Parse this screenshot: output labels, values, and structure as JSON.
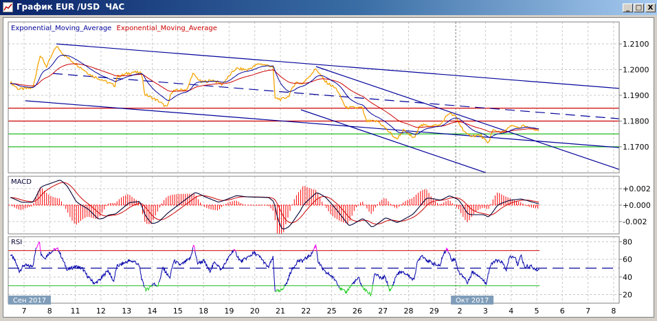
{
  "window": {
    "title": "График EUR /USD  ЧАС",
    "minimize_glyph": "_",
    "maximize_glyph": "□",
    "close_glyph": "X"
  },
  "legend": {
    "ema_fast": "Exponential_Moving_Average",
    "ema_slow": "Exponential_Moving_Average"
  },
  "colors": {
    "price": "#F5A300",
    "ema_fast": "#000099",
    "ema_slow": "#CC0000",
    "trend": "#000099",
    "resistance": "#CC0000",
    "support": "#22BB22",
    "macd": "#000033",
    "signal": "#CC0000",
    "histogram": "#FF0000",
    "rsi": "#0000AA",
    "rsi_over": "#EE00EE",
    "rsi_under": "#22CC22"
  },
  "x_axis": {
    "ticks": [
      {
        "d": 0,
        "label": "7"
      },
      {
        "d": 1,
        "label": "8"
      },
      {
        "d": 2,
        "label": "11"
      },
      {
        "d": 3,
        "label": "12"
      },
      {
        "d": 4,
        "label": "13"
      },
      {
        "d": 5,
        "label": "14"
      },
      {
        "d": 6,
        "label": "15"
      },
      {
        "d": 7,
        "label": "18"
      },
      {
        "d": 8,
        "label": "19"
      },
      {
        "d": 9,
        "label": "20"
      },
      {
        "d": 10,
        "label": "21"
      },
      {
        "d": 11,
        "label": "22"
      },
      {
        "d": 12,
        "label": "25"
      },
      {
        "d": 13,
        "label": "26"
      },
      {
        "d": 14,
        "label": "27"
      },
      {
        "d": 15,
        "label": "28"
      },
      {
        "d": 16,
        "label": "29"
      },
      {
        "d": 17,
        "label": "2"
      },
      {
        "d": 18,
        "label": "3"
      },
      {
        "d": 19,
        "label": "4"
      },
      {
        "d": 20,
        "label": "5"
      },
      {
        "d": 21,
        "label": "6"
      },
      {
        "d": 22,
        "label": "7"
      },
      {
        "d": 23,
        "label": "8"
      }
    ],
    "months": [
      {
        "d": -0.62,
        "label": "Сен 2017"
      },
      {
        "d": 16.84,
        "label": "Окт 2017"
      }
    ],
    "month_separator_d": 16.84
  },
  "chart_data": [
    {
      "type": "line",
      "title": "EUR/USD H1",
      "ylim": [
        1.1599,
        1.2186
      ],
      "xlim": [
        -0.62,
        23.22
      ],
      "yticks": [
        "1.2100",
        "1.2000",
        "1.1900",
        "1.1800",
        "1.1700"
      ],
      "price": [
        [
          -0.54,
          1.1951
        ],
        [
          -0.21,
          1.1924
        ],
        [
          0.35,
          1.1929
        ],
        [
          0.62,
          1.2057
        ],
        [
          0.88,
          1.2012
        ],
        [
          1.26,
          1.2092
        ],
        [
          1.56,
          1.2057
        ],
        [
          2.01,
          1.2023
        ],
        [
          2.63,
          1.1977
        ],
        [
          3.08,
          1.1959
        ],
        [
          3.54,
          1.1937
        ],
        [
          3.62,
          1.1972
        ],
        [
          4.24,
          1.1991
        ],
        [
          4.61,
          1.1985
        ],
        [
          4.69,
          1.1905
        ],
        [
          5.23,
          1.1879
        ],
        [
          5.58,
          1.1852
        ],
        [
          5.76,
          1.1916
        ],
        [
          6.38,
          1.1924
        ],
        [
          6.57,
          1.1985
        ],
        [
          6.92,
          1.1951
        ],
        [
          7.37,
          1.1959
        ],
        [
          7.72,
          1.1943
        ],
        [
          8.26,
          1.2004
        ],
        [
          8.71,
          1.1999
        ],
        [
          9.17,
          1.2023
        ],
        [
          9.71,
          1.2012
        ],
        [
          9.79,
          1.1889
        ],
        [
          10.05,
          1.1884
        ],
        [
          10.32,
          1.1897
        ],
        [
          10.59,
          1.1951
        ],
        [
          10.86,
          1.1945
        ],
        [
          11.15,
          1.1977
        ],
        [
          11.39,
          1.2004
        ],
        [
          11.72,
          1.1956
        ],
        [
          12.2,
          1.1924
        ],
        [
          12.55,
          1.1852
        ],
        [
          13.19,
          1.1852
        ],
        [
          13.35,
          1.1799
        ],
        [
          13.81,
          1.1799
        ],
        [
          14.26,
          1.1756
        ],
        [
          14.53,
          1.1729
        ],
        [
          14.8,
          1.1764
        ],
        [
          15.23,
          1.1732
        ],
        [
          15.42,
          1.1783
        ],
        [
          16.22,
          1.1783
        ],
        [
          16.57,
          1.1831
        ],
        [
          16.84,
          1.1817
        ],
        [
          17.02,
          1.1783
        ],
        [
          17.29,
          1.1745
        ],
        [
          17.83,
          1.1743
        ],
        [
          18.1,
          1.1711
        ],
        [
          18.28,
          1.1764
        ],
        [
          18.71,
          1.1756
        ],
        [
          18.98,
          1.1783
        ],
        [
          19.36,
          1.1772
        ],
        [
          19.44,
          1.1785
        ],
        [
          19.79,
          1.1769
        ],
        [
          20.11,
          1.1761
        ]
      ],
      "levels": [
        {
          "kind": "resistance",
          "value": 1.185
        },
        {
          "kind": "resistance",
          "value": 1.18
        },
        {
          "kind": "support",
          "value": 1.175
        },
        {
          "kind": "support",
          "value": 1.17
        }
      ],
      "trendlines": [
        {
          "from": [
            1.26,
            1.21
          ],
          "to": [
            23.22,
            1.1927
          ],
          "dashed": false
        },
        {
          "from": [
            1.13,
            1.1985
          ],
          "to": [
            23.22,
            1.1809
          ],
          "dashed": true
        },
        {
          "from": [
            0.05,
            1.1879
          ],
          "to": [
            23.22,
            1.1697
          ],
          "dashed": false
        },
        {
          "from": [
            11.39,
            1.2012
          ],
          "to": [
            23.22,
            1.1612
          ],
          "dashed": false
        },
        {
          "from": [
            10.8,
            1.1844
          ],
          "to": [
            18.02,
            1.1599
          ],
          "dashed": false
        }
      ]
    },
    {
      "type": "line",
      "title": "MACD",
      "ylim": [
        -0.0035,
        0.0035
      ],
      "yticks": [
        "+0.002",
        "+0.000",
        "-0.002"
      ],
      "macd": [
        [
          -0.54,
          0.00092
        ],
        [
          -0.13,
          0.00033
        ],
        [
          0.32,
          0.00033
        ],
        [
          0.62,
          0.00225
        ],
        [
          0.94,
          0.00258
        ],
        [
          1.39,
          0.00308
        ],
        [
          1.66,
          0.00225
        ],
        [
          2.01,
          0.00033
        ],
        [
          2.47,
          -0.0005
        ],
        [
          2.87,
          -0.00175
        ],
        [
          3.08,
          -0.00158
        ],
        [
          3.27,
          -0.00117
        ],
        [
          3.54,
          -0.00108
        ],
        [
          4.07,
          0.00033
        ],
        [
          4.5,
          0.00042
        ],
        [
          4.69,
          -0.00133
        ],
        [
          4.96,
          -0.00233
        ],
        [
          5.23,
          -0.002
        ],
        [
          5.58,
          -0.00092
        ],
        [
          6.11,
          0.00033
        ],
        [
          6.65,
          0.00158
        ],
        [
          7.02,
          0.001
        ],
        [
          7.56,
          0.00033
        ],
        [
          8.26,
          0.00117
        ],
        [
          8.63,
          0.001
        ],
        [
          9.52,
          0.00092
        ],
        [
          9.73,
          0.00033
        ],
        [
          9.87,
          -0.00192
        ],
        [
          10.05,
          -0.00308
        ],
        [
          10.32,
          -0.00258
        ],
        [
          10.78,
          -0.0005
        ],
        [
          10.86,
          8e-05
        ],
        [
          11.39,
          0.00158
        ],
        [
          11.74,
          0.00092
        ],
        [
          12.2,
          -0.00075
        ],
        [
          12.65,
          -0.00258
        ],
        [
          13.19,
          -0.00158
        ],
        [
          13.54,
          -0.00275
        ],
        [
          14.08,
          -0.0015
        ],
        [
          14.53,
          -0.00217
        ],
        [
          15.15,
          -0.00108
        ],
        [
          15.68,
          0.00092
        ],
        [
          16.22,
          0.00058
        ],
        [
          16.57,
          0.00117
        ],
        [
          16.94,
          0.00058
        ],
        [
          17.29,
          -0.00117
        ],
        [
          17.91,
          -0.00117
        ],
        [
          18.1,
          -0.0015
        ],
        [
          18.45,
          8e-05
        ],
        [
          18.9,
          0.00058
        ],
        [
          19.36,
          0.00075
        ],
        [
          20.11,
          8e-05
        ]
      ]
    },
    {
      "type": "line",
      "title": "RSI",
      "ylim": [
        11,
        87
      ],
      "yticks": [
        "80",
        "60",
        "40",
        "20"
      ],
      "levels": {
        "upper": 70,
        "middle": 50,
        "lower": 30
      },
      "rsi": [
        [
          -0.54,
          66
        ],
        [
          -0.35,
          58.2
        ],
        [
          -0.19,
          46.5
        ],
        [
          0,
          53.5
        ],
        [
          0.21,
          52
        ],
        [
          0.35,
          53.5
        ],
        [
          0.46,
          71.4
        ],
        [
          0.59,
          81.6
        ],
        [
          0.67,
          66
        ],
        [
          0.8,
          61.3
        ],
        [
          0.99,
          67.5
        ],
        [
          1.21,
          71.4
        ],
        [
          1.34,
          71.4
        ],
        [
          1.47,
          62
        ],
        [
          1.69,
          48
        ],
        [
          2.01,
          52
        ],
        [
          2.28,
          49.6
        ],
        [
          2.49,
          40.2
        ],
        [
          2.76,
          32.4
        ],
        [
          3.0,
          37.9
        ],
        [
          3.27,
          48
        ],
        [
          3.49,
          34.8
        ],
        [
          3.62,
          52
        ],
        [
          4.07,
          58.2
        ],
        [
          4.34,
          57.4
        ],
        [
          4.5,
          52
        ],
        [
          4.61,
          34.8
        ],
        [
          4.77,
          24.7
        ],
        [
          5.04,
          32.4
        ],
        [
          5.23,
          30.1
        ],
        [
          5.42,
          50.4
        ],
        [
          5.68,
          38.7
        ],
        [
          5.84,
          58.2
        ],
        [
          6.11,
          53.5
        ],
        [
          6.49,
          61.3
        ],
        [
          6.62,
          76.9
        ],
        [
          6.76,
          55.8
        ],
        [
          7.02,
          58.2
        ],
        [
          7.24,
          46.5
        ],
        [
          7.45,
          57.4
        ],
        [
          7.69,
          48
        ],
        [
          8.18,
          71.4
        ],
        [
          8.45,
          57.4
        ],
        [
          8.71,
          62
        ],
        [
          8.98,
          67.5
        ],
        [
          9.25,
          61.3
        ],
        [
          9.52,
          50.4
        ],
        [
          9.71,
          62
        ],
        [
          9.79,
          24.7
        ],
        [
          9.97,
          23.1
        ],
        [
          10.24,
          32.4
        ],
        [
          10.4,
          45.7
        ],
        [
          10.67,
          58.2
        ],
        [
          10.86,
          58.2
        ],
        [
          11.21,
          66
        ],
        [
          11.39,
          76.9
        ],
        [
          11.47,
          57.4
        ],
        [
          11.72,
          45.7
        ],
        [
          11.93,
          42.6
        ],
        [
          12.2,
          34.8
        ],
        [
          12.33,
          27
        ],
        [
          12.55,
          22.3
        ],
        [
          12.82,
          32.4
        ],
        [
          13.06,
          38.7
        ],
        [
          13.19,
          28.6
        ],
        [
          13.54,
          19.2
        ],
        [
          13.67,
          44.1
        ],
        [
          13.94,
          37.9
        ],
        [
          14.08,
          40.2
        ],
        [
          14.29,
          23.1
        ],
        [
          14.53,
          42.6
        ],
        [
          14.69,
          45.7
        ],
        [
          14.96,
          42.6
        ],
        [
          15.2,
          36.4
        ],
        [
          15.34,
          55.8
        ],
        [
          15.5,
          65.2
        ],
        [
          15.76,
          58.2
        ],
        [
          16.03,
          54.3
        ],
        [
          16.22,
          52
        ],
        [
          16.3,
          61.3
        ],
        [
          16.49,
          73
        ],
        [
          16.68,
          59.7
        ],
        [
          16.84,
          59.7
        ],
        [
          16.94,
          45.7
        ],
        [
          17.21,
          38.7
        ],
        [
          17.29,
          32.4
        ],
        [
          17.48,
          45.7
        ],
        [
          17.75,
          41.8
        ],
        [
          18.02,
          32.4
        ],
        [
          18.18,
          52
        ],
        [
          18.36,
          58.2
        ],
        [
          18.63,
          57.4
        ],
        [
          18.82,
          48
        ],
        [
          18.95,
          63.6
        ],
        [
          19.17,
          61.3
        ],
        [
          19.25,
          53.5
        ],
        [
          19.38,
          65.2
        ],
        [
          19.52,
          52
        ],
        [
          19.79,
          52
        ],
        [
          19.97,
          48
        ],
        [
          20.11,
          48.8
        ]
      ]
    }
  ]
}
